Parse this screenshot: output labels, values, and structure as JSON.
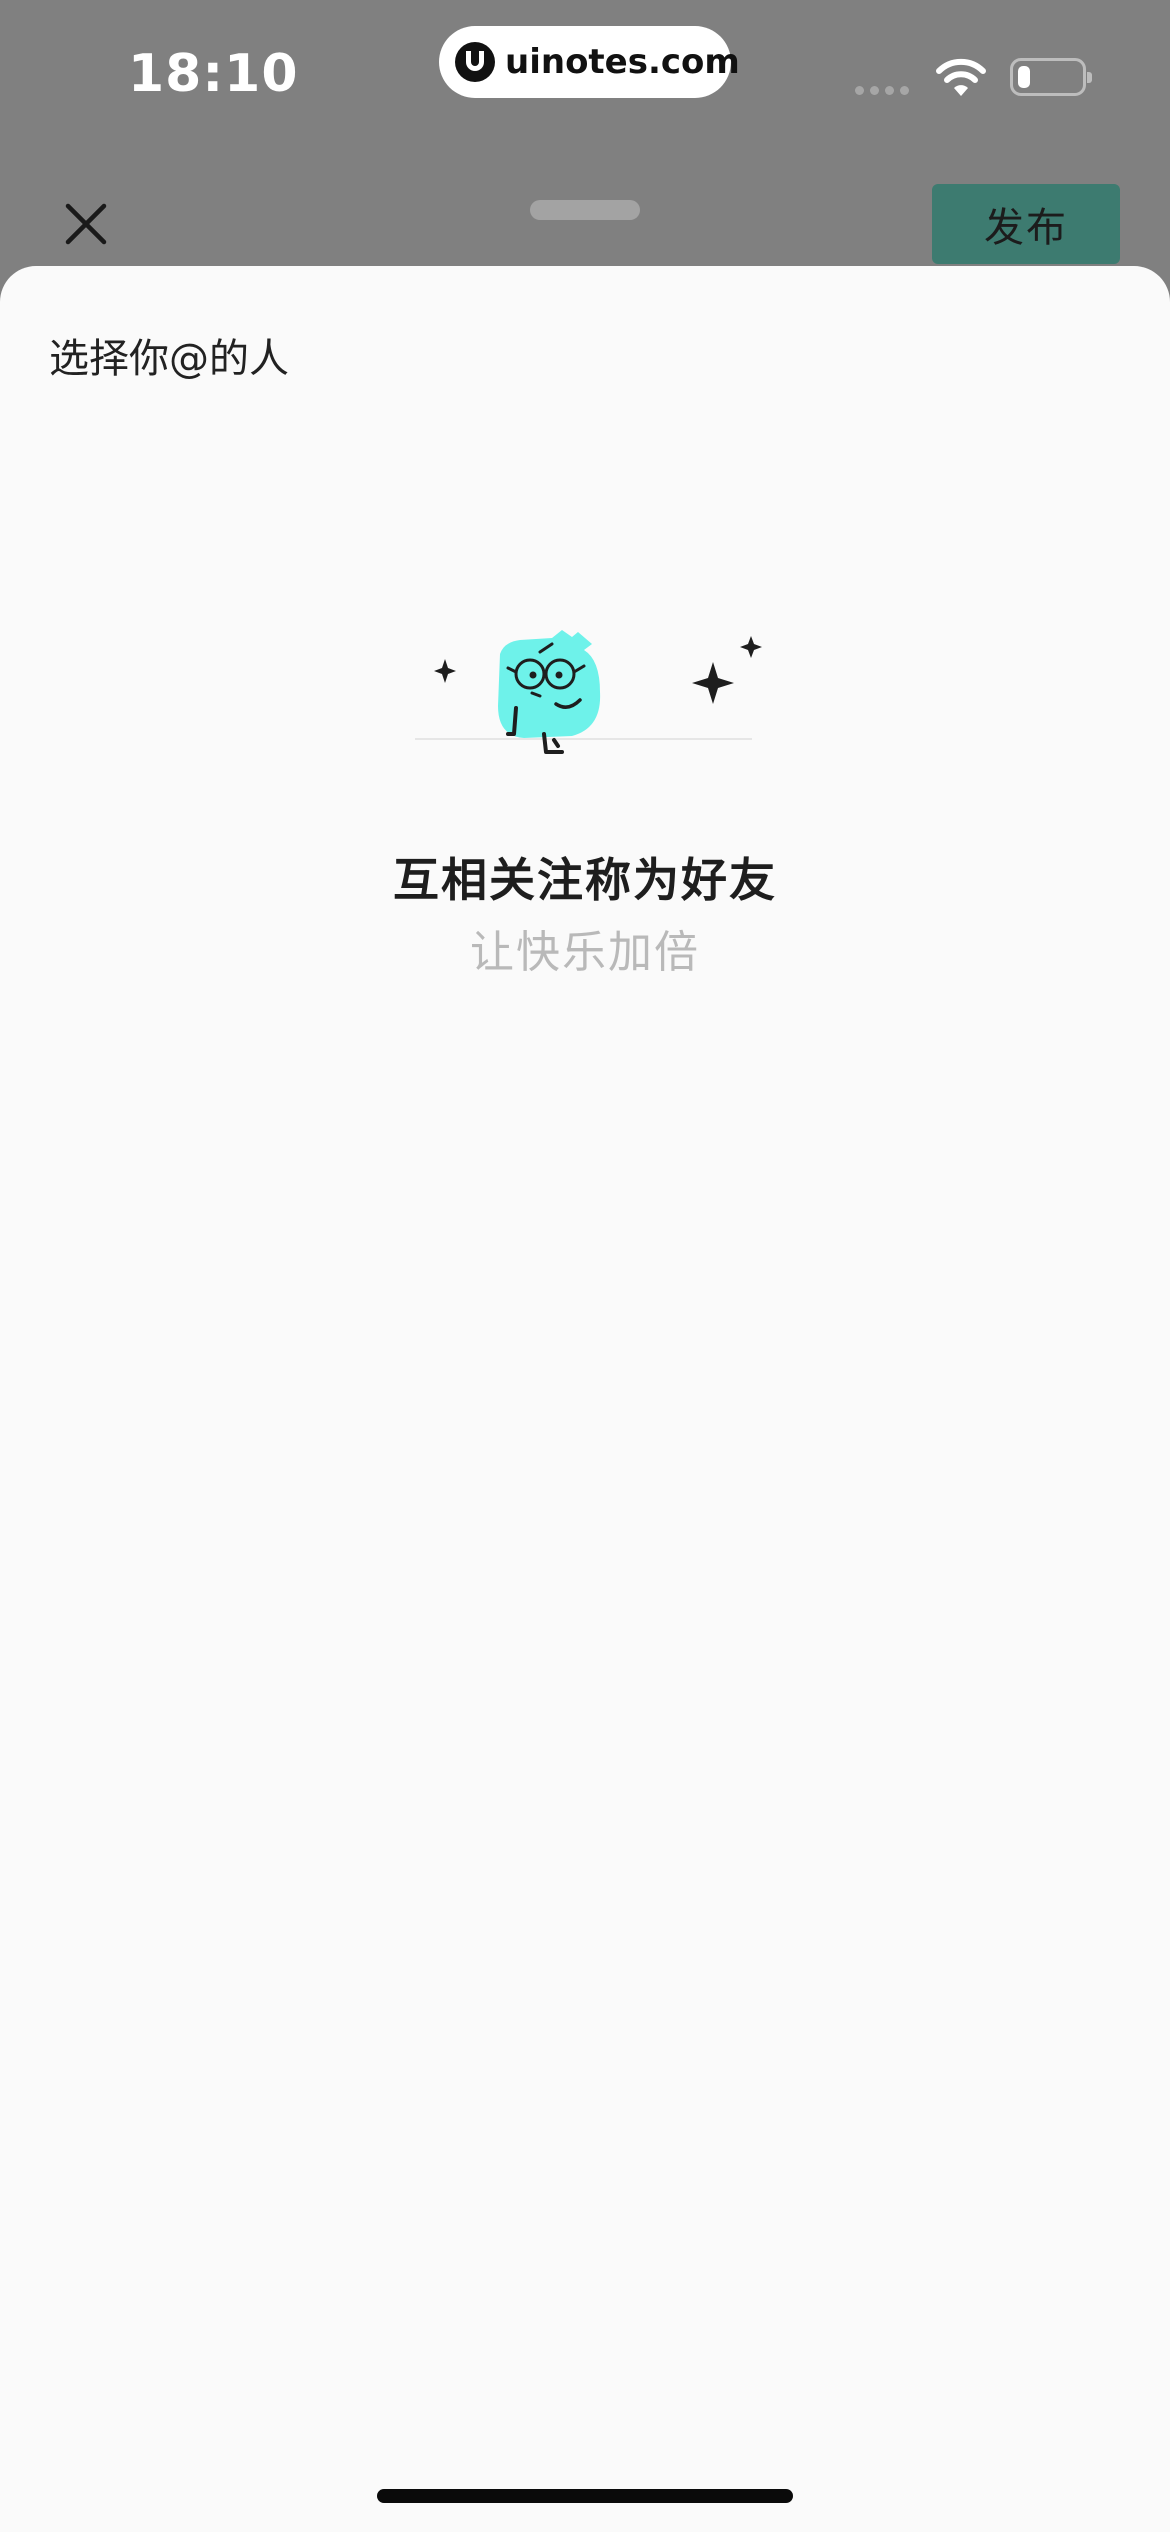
{
  "status_bar": {
    "time": "18:10",
    "watermark": "uinotes.com",
    "battery_level_fraction": 0.2
  },
  "header": {
    "close_icon": "close-icon",
    "publish_label": "发布",
    "publish_color": "#3d7b70"
  },
  "sheet": {
    "title": "选择你@的人",
    "empty_state": {
      "illustration": "mascot-with-glasses-illustration",
      "mascot_color": "#6ef2ea",
      "title": "互相关注称为好友",
      "subtitle": "让快乐加倍"
    }
  }
}
